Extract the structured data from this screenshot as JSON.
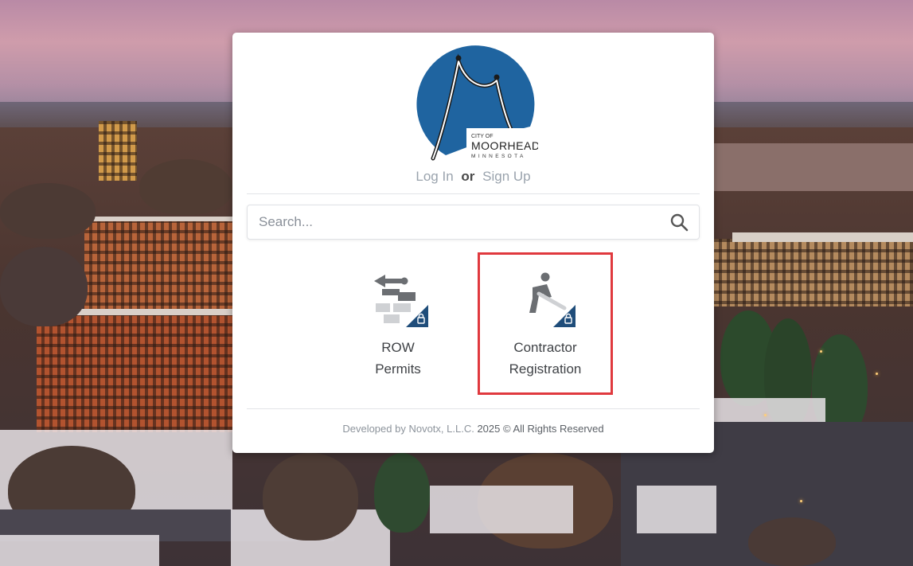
{
  "logo": {
    "city_of": "CITY OF",
    "name": "MOORHEAD",
    "state": "MINNESOTA"
  },
  "auth": {
    "login": "Log In",
    "or": "or",
    "signup": "Sign Up"
  },
  "search": {
    "placeholder": "Search..."
  },
  "tiles": [
    {
      "line1": "ROW",
      "line2": "Permits",
      "icon": "shovel-bricks-lock-icon"
    },
    {
      "line1": "Contractor",
      "line2": "Registration",
      "icon": "worker-lock-icon",
      "highlighted": true
    }
  ],
  "footer": {
    "developed_by": "Developed by Novotx, L.L.C.",
    "year": "2025",
    "rights": "© All Rights Reserved"
  },
  "colors": {
    "logo_blue": "#1f64a0",
    "icon_gray": "#6b6e72",
    "lock_badge": "#1f4d7a",
    "highlight_red": "#e0393e"
  }
}
